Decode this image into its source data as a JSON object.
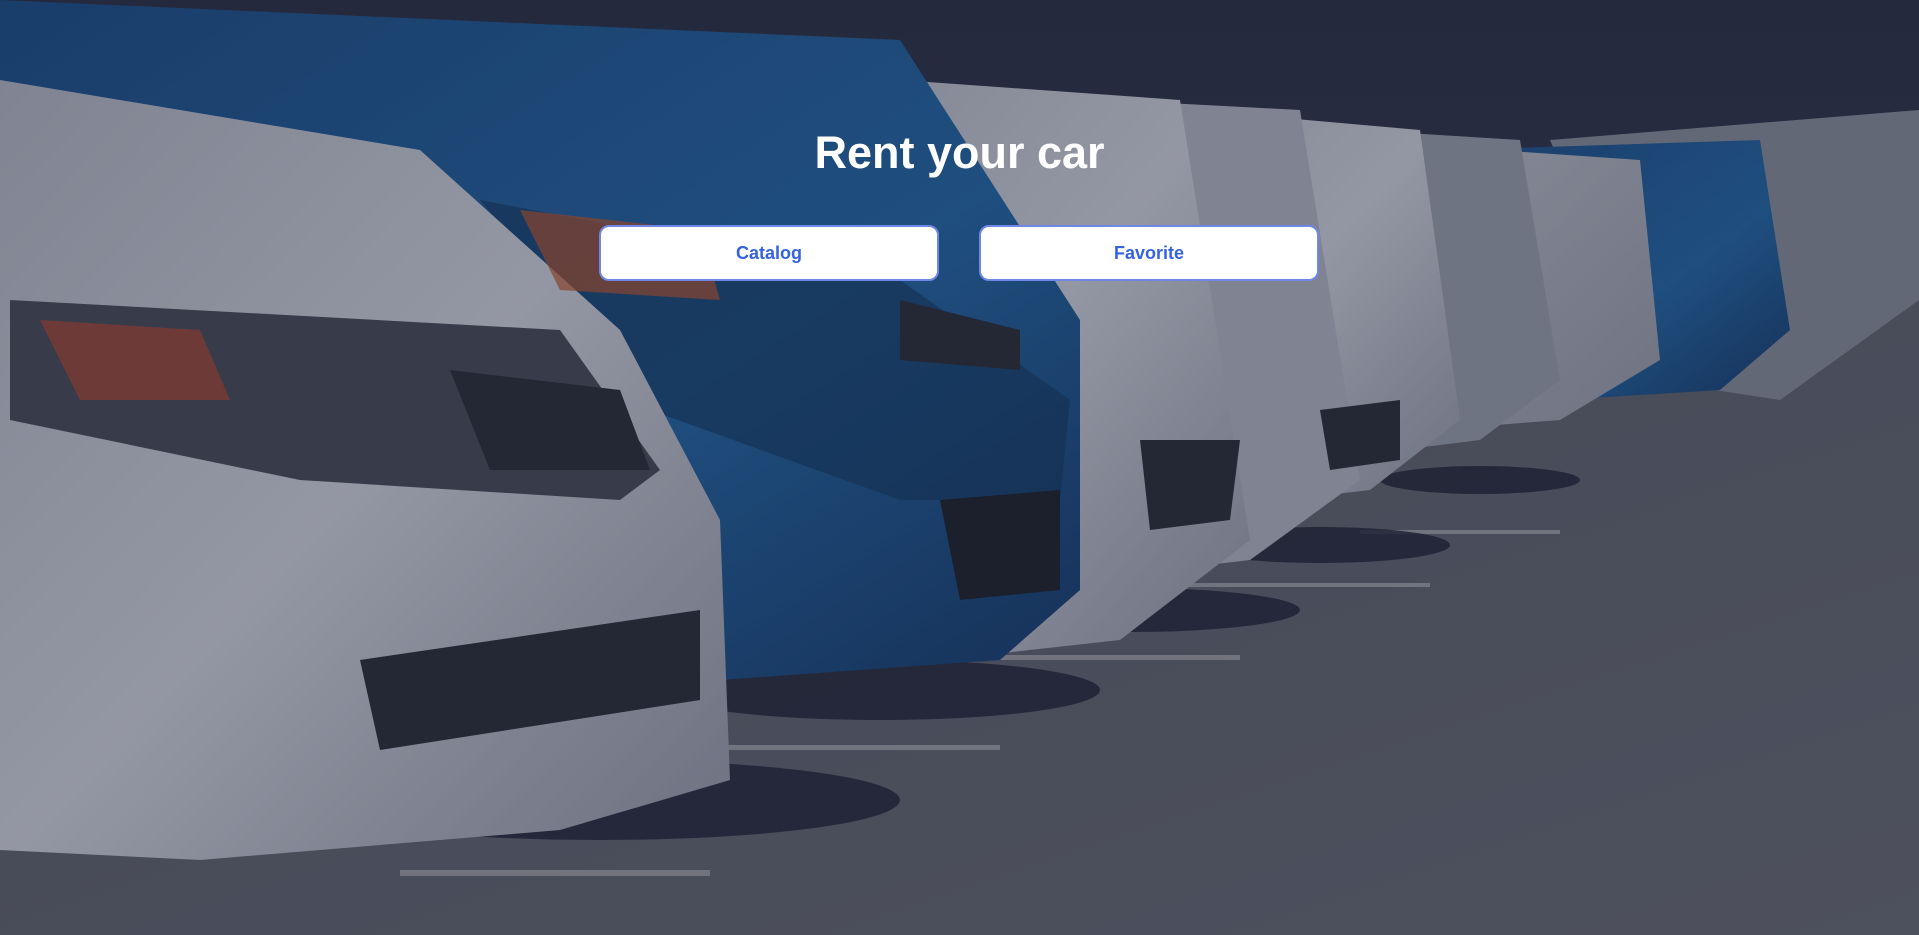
{
  "hero": {
    "title": "Rent your car",
    "overlay_color": "#181e37"
  },
  "nav": {
    "catalog_label": "Catalog",
    "favorite_label": "Favorite"
  },
  "colors": {
    "button_text": "#3462e0",
    "button_border": "#6f88e8",
    "button_bg": "#ffffff",
    "title_text": "#ffffff"
  }
}
